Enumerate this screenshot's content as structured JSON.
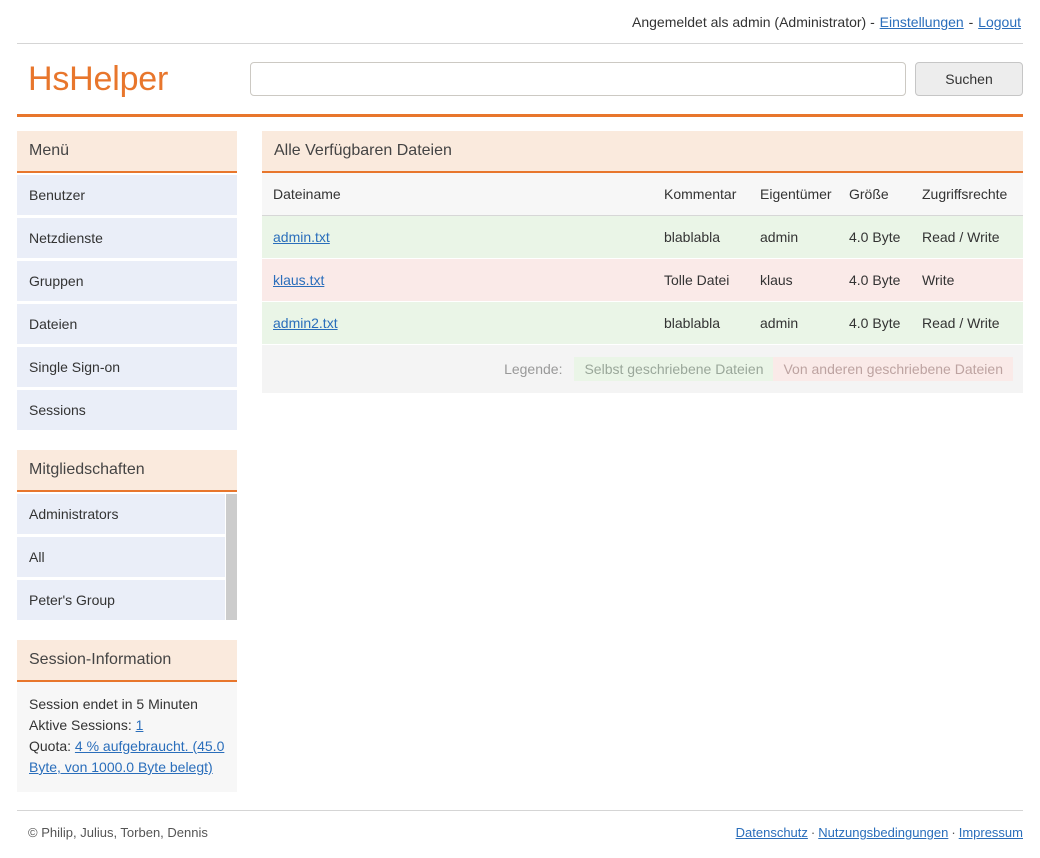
{
  "topbar": {
    "status_text": "Angemeldet als admin (Administrator) - ",
    "settings_link": "Einstellungen",
    "separator": " - ",
    "logout_link": "Logout"
  },
  "brand": {
    "name": "HsHelper",
    "color": "#e8762c"
  },
  "search": {
    "value": "",
    "placeholder": "",
    "button_label": "Suchen"
  },
  "sidebar": {
    "menu": {
      "title": "Menü",
      "items": [
        {
          "label": "Benutzer"
        },
        {
          "label": "Netzdienste"
        },
        {
          "label": "Gruppen"
        },
        {
          "label": "Dateien"
        },
        {
          "label": "Single Sign-on"
        },
        {
          "label": "Sessions"
        }
      ]
    },
    "memberships": {
      "title": "Mitgliedschaften",
      "items": [
        {
          "label": "Administrators"
        },
        {
          "label": "All"
        },
        {
          "label": "Peter's Group"
        }
      ]
    },
    "session": {
      "title": "Session-Information",
      "ends_text": "Session endet in 5 Minuten",
      "active_label": "Aktive Sessions: ",
      "active_value": "1",
      "quota_label": "Quota: ",
      "quota_value": "4 % aufgebraucht. (45.0 Byte, von 1000.0 Byte belegt)"
    }
  },
  "main": {
    "title": "Alle Verfügbaren Dateien",
    "columns": [
      "Dateiname",
      "Kommentar",
      "Eigentümer",
      "Größe",
      "Zugriffsrechte"
    ],
    "rows": [
      {
        "filename": "admin.txt",
        "comment": "blablabla",
        "owner": "admin",
        "size": "4.0 Byte",
        "rights": "Read / Write",
        "kind": "own"
      },
      {
        "filename": "klaus.txt",
        "comment": "Tolle Datei",
        "owner": "klaus",
        "size": "4.0 Byte",
        "rights": "Write",
        "kind": "other"
      },
      {
        "filename": "admin2.txt",
        "comment": "blablabla",
        "owner": "admin",
        "size": "4.0 Byte",
        "rights": "Read / Write",
        "kind": "own"
      }
    ],
    "legend": {
      "label": "Legende:",
      "own": "Selbst geschriebene Dateien",
      "other": "Von anderen geschriebene Dateien",
      "own_color": "#eaf5e7",
      "other_color": "#faeae8"
    }
  },
  "footer": {
    "copyright": "© Philip, Julius, Torben, Dennis",
    "links": [
      "Datenschutz",
      "Nutzungsbedingungen",
      "Impressum"
    ],
    "separator": "·"
  }
}
